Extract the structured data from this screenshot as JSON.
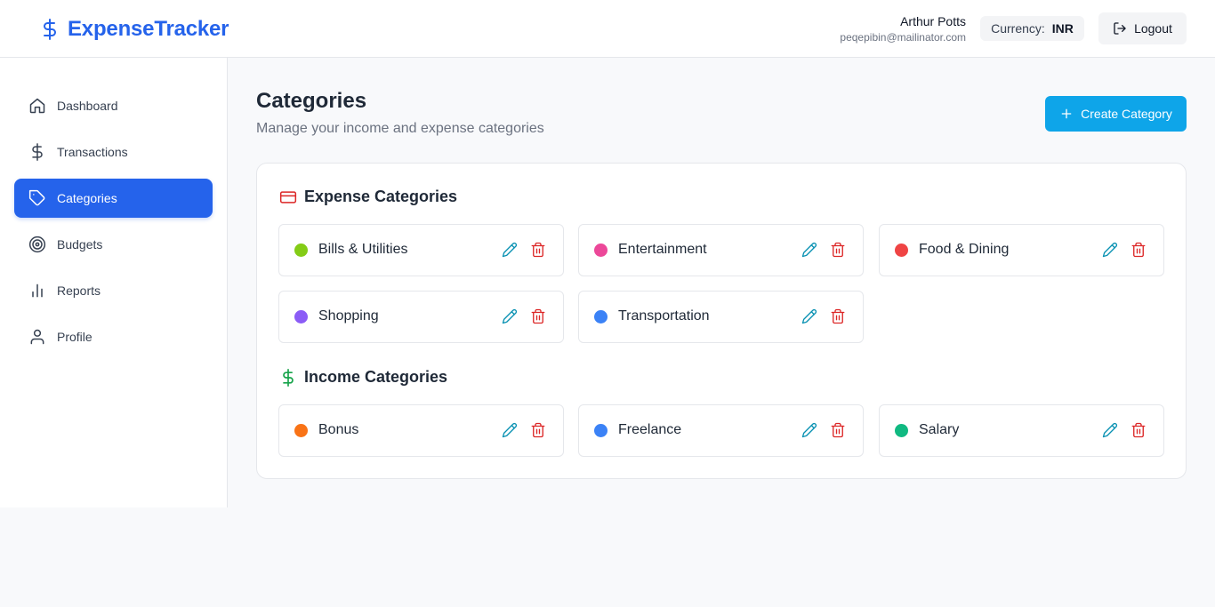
{
  "brand": {
    "name": "ExpenseTracker"
  },
  "user": {
    "name": "Arthur Potts",
    "email": "peqepibin@mailinator.com"
  },
  "currency": {
    "label": "Currency:",
    "value": "INR"
  },
  "logout": {
    "label": "Logout"
  },
  "nav": {
    "items": [
      {
        "label": "Dashboard",
        "icon": "home-icon"
      },
      {
        "label": "Transactions",
        "icon": "dollar-icon"
      },
      {
        "label": "Categories",
        "icon": "tag-icon",
        "active": true
      },
      {
        "label": "Budgets",
        "icon": "target-icon"
      },
      {
        "label": "Reports",
        "icon": "bar-chart-icon"
      },
      {
        "label": "Profile",
        "icon": "user-icon"
      }
    ]
  },
  "page": {
    "title": "Categories",
    "subtitle": "Manage your income and expense categories",
    "create_label": "Create Category"
  },
  "expense": {
    "heading": "Expense Categories",
    "items": [
      {
        "name": "Bills & Utilities",
        "color": "#84cc16"
      },
      {
        "name": "Entertainment",
        "color": "#ec4899"
      },
      {
        "name": "Food & Dining",
        "color": "#ef4444"
      },
      {
        "name": "Shopping",
        "color": "#8b5cf6"
      },
      {
        "name": "Transportation",
        "color": "#3b82f6"
      }
    ]
  },
  "income": {
    "heading": "Income Categories",
    "items": [
      {
        "name": "Bonus",
        "color": "#f97316"
      },
      {
        "name": "Freelance",
        "color": "#3b82f6"
      },
      {
        "name": "Salary",
        "color": "#10b981"
      }
    ]
  },
  "colors": {
    "primary": "#2563eb",
    "create_button": "#0ea5e9",
    "edit_icon": "#0891b2",
    "delete_icon": "#dc2626",
    "expense_icon": "#dc2626",
    "income_icon": "#16a34a"
  }
}
